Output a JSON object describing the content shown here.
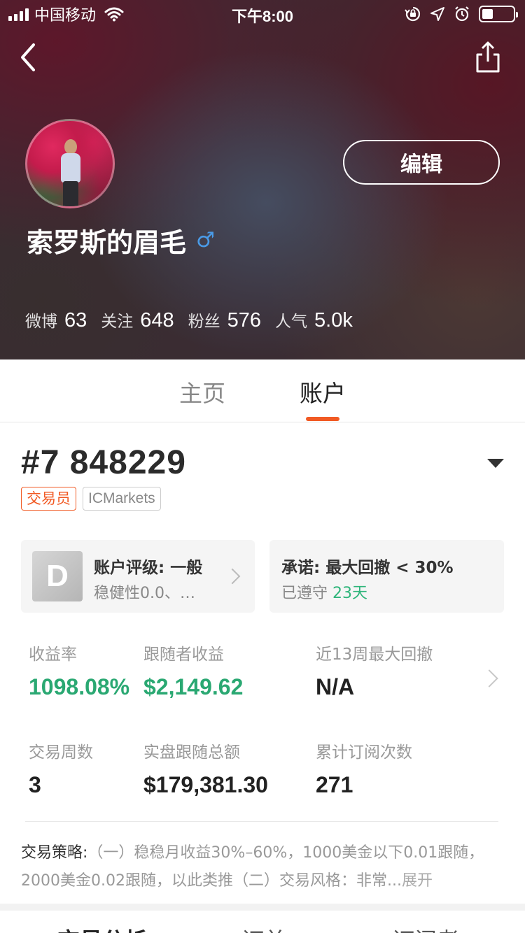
{
  "status_bar": {
    "carrier": "中国移动",
    "time": "下午8:00"
  },
  "header": {
    "edit_label": "编辑",
    "username": "索罗斯的眉毛",
    "gender_symbol": "♂",
    "stats": [
      {
        "label": "微博",
        "value": "63"
      },
      {
        "label": "关注",
        "value": "648"
      },
      {
        "label": "粉丝",
        "value": "576"
      },
      {
        "label": "人气",
        "value": "5.0k"
      }
    ]
  },
  "tabs": [
    {
      "label": "主页",
      "active": false
    },
    {
      "label": "账户",
      "active": true
    }
  ],
  "account": {
    "id": "#7 848229",
    "tags": [
      "交易员",
      "ICMarkets"
    ],
    "rating_card": {
      "grade": "D",
      "title": "账户评级: 一般",
      "subtitle": "稳健性0.0、…"
    },
    "promise_card": {
      "title": "承诺: 最大回撤 < 30%",
      "subtitle_prefix": "已遵守 ",
      "days": "23天"
    },
    "metrics": [
      {
        "label": "收益率",
        "value": "1098.08%"
      },
      {
        "label": "跟随者收益",
        "value": "$2,149.62"
      },
      {
        "label": "近13周最大回撤",
        "value": "N/A"
      },
      {
        "label": "交易周数",
        "value": "3"
      },
      {
        "label": "实盘跟随总额",
        "value": "$179,381.30"
      },
      {
        "label": "累计订阅次数",
        "value": "271"
      }
    ],
    "strategy": {
      "label": "交易策略:",
      "text": "（一）稳稳月收益30%–60%，1000美金以下0.01跟随，2000美金0.02跟随，以此类推（二）交易风格：非常...",
      "expand": "展开"
    }
  },
  "bottom_tabs": [
    {
      "label": "交易分析",
      "active": true
    },
    {
      "label": "订单",
      "active": false
    },
    {
      "label": "订阅者",
      "active": false
    }
  ],
  "colors": {
    "accent": "#f15a24",
    "positive": "#2aa872",
    "gender_male": "#4a9be8"
  }
}
